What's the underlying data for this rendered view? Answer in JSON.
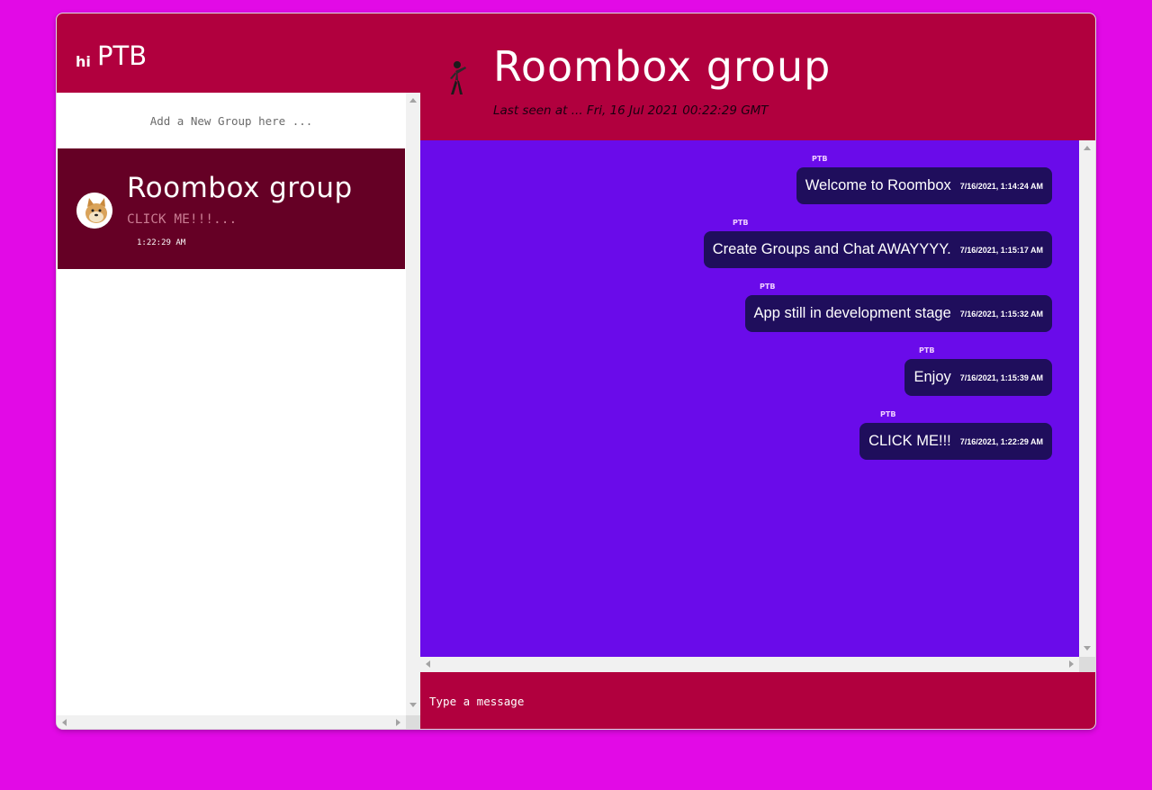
{
  "colors": {
    "page_bg": "#e20ae6",
    "header_bg": "#b1003e",
    "selected_group_bg": "#650025",
    "chat_bg": "#6a0bea",
    "bubble_bg": "#1f0e5c"
  },
  "sidebar": {
    "greeting": "hi",
    "username": "PTB",
    "add_group_placeholder": "Add a New Group here ...",
    "groups": [
      {
        "name": "Roombox group",
        "last_message": "CLICK ME!!!...",
        "time": "1:22:29 AM",
        "avatar_icon": "doge-avatar-icon"
      }
    ]
  },
  "chat": {
    "title": "Roombox group",
    "last_seen": "Last seen at ... Fri, 16 Jul 2021 00:22:29 GMT",
    "avatar_icon": "figure-avatar-icon",
    "messages": [
      {
        "sender": "PTB",
        "text": "Welcome to Roombox",
        "time": "7/16/2021, 1:14:24 AM"
      },
      {
        "sender": "PTB",
        "text": "Create Groups and Chat AWAYYYY.",
        "time": "7/16/2021, 1:15:17 AM"
      },
      {
        "sender": "PTB",
        "text": "App still in development stage",
        "time": "7/16/2021, 1:15:32 AM"
      },
      {
        "sender": "PTB",
        "text": "Enjoy",
        "time": "7/16/2021, 1:15:39 AM"
      },
      {
        "sender": "PTB",
        "text": "CLICK ME!!!",
        "time": "7/16/2021, 1:22:29 AM"
      }
    ],
    "composer_placeholder": "Type a message"
  }
}
